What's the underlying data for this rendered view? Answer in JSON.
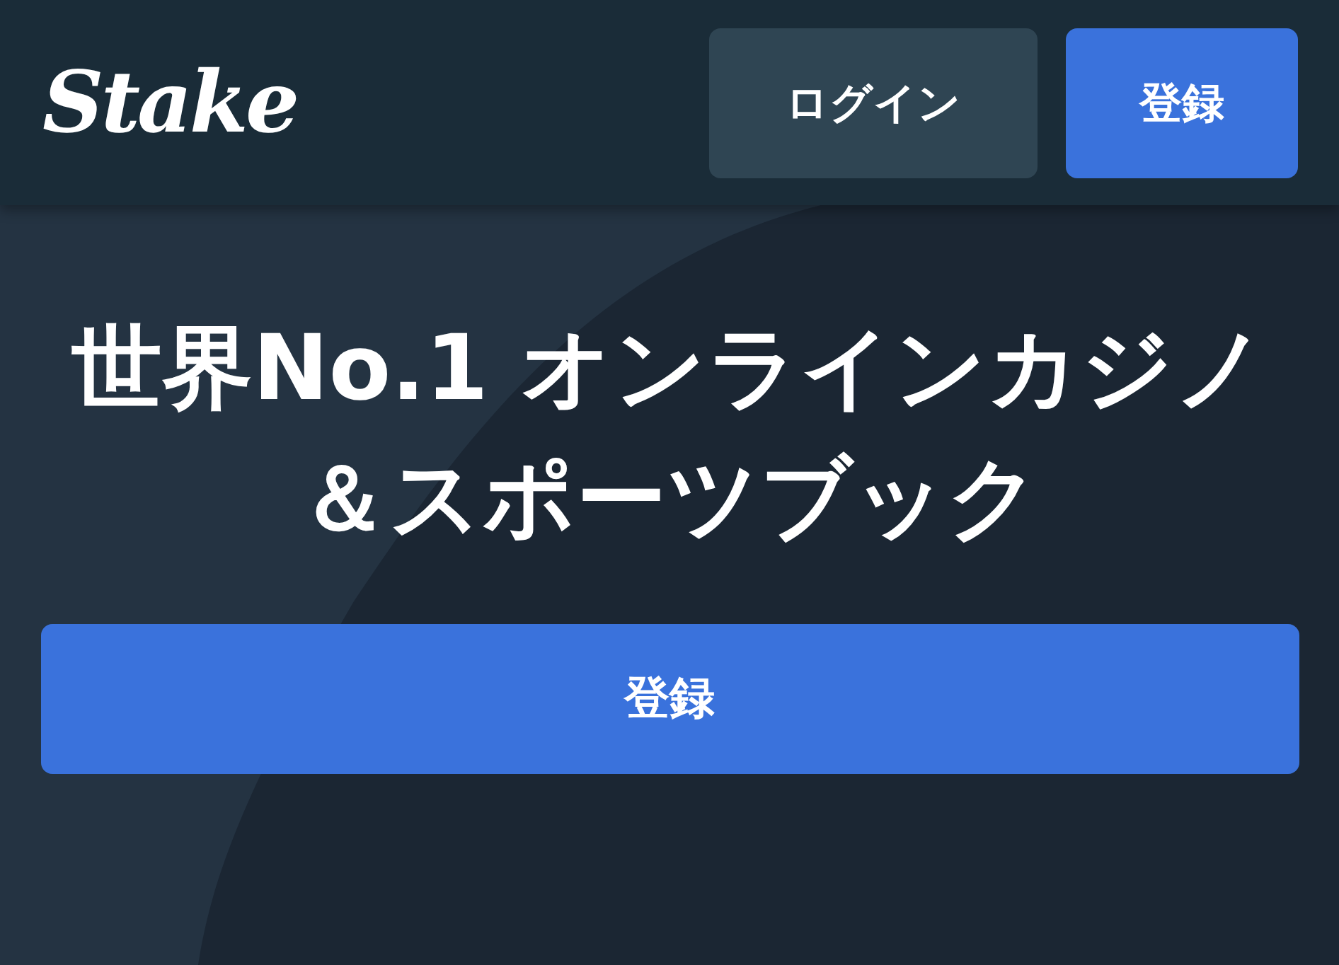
{
  "header": {
    "logo": "Stake",
    "buttons": [
      {
        "label": "ログイン",
        "kind": "secondary"
      },
      {
        "label": "登録",
        "kind": "primary"
      }
    ]
  },
  "hero": {
    "title": "世界No.1 オンラインカジノ＆スポーツブック",
    "button": {
      "label": "登録",
      "kind": "primary"
    }
  }
}
